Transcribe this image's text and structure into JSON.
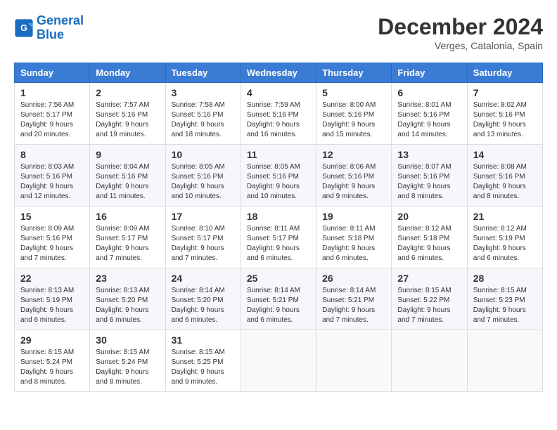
{
  "header": {
    "logo_general": "General",
    "logo_blue": "Blue",
    "month": "December 2024",
    "location": "Verges, Catalonia, Spain"
  },
  "weekdays": [
    "Sunday",
    "Monday",
    "Tuesday",
    "Wednesday",
    "Thursday",
    "Friday",
    "Saturday"
  ],
  "weeks": [
    [
      {
        "day": "1",
        "sunrise": "Sunrise: 7:56 AM",
        "sunset": "Sunset: 5:17 PM",
        "daylight": "Daylight: 9 hours and 20 minutes."
      },
      {
        "day": "2",
        "sunrise": "Sunrise: 7:57 AM",
        "sunset": "Sunset: 5:16 PM",
        "daylight": "Daylight: 9 hours and 19 minutes."
      },
      {
        "day": "3",
        "sunrise": "Sunrise: 7:58 AM",
        "sunset": "Sunset: 5:16 PM",
        "daylight": "Daylight: 9 hours and 18 minutes."
      },
      {
        "day": "4",
        "sunrise": "Sunrise: 7:59 AM",
        "sunset": "Sunset: 5:16 PM",
        "daylight": "Daylight: 9 hours and 16 minutes."
      },
      {
        "day": "5",
        "sunrise": "Sunrise: 8:00 AM",
        "sunset": "Sunset: 5:16 PM",
        "daylight": "Daylight: 9 hours and 15 minutes."
      },
      {
        "day": "6",
        "sunrise": "Sunrise: 8:01 AM",
        "sunset": "Sunset: 5:16 PM",
        "daylight": "Daylight: 9 hours and 14 minutes."
      },
      {
        "day": "7",
        "sunrise": "Sunrise: 8:02 AM",
        "sunset": "Sunset: 5:16 PM",
        "daylight": "Daylight: 9 hours and 13 minutes."
      }
    ],
    [
      {
        "day": "8",
        "sunrise": "Sunrise: 8:03 AM",
        "sunset": "Sunset: 5:16 PM",
        "daylight": "Daylight: 9 hours and 12 minutes."
      },
      {
        "day": "9",
        "sunrise": "Sunrise: 8:04 AM",
        "sunset": "Sunset: 5:16 PM",
        "daylight": "Daylight: 9 hours and 11 minutes."
      },
      {
        "day": "10",
        "sunrise": "Sunrise: 8:05 AM",
        "sunset": "Sunset: 5:16 PM",
        "daylight": "Daylight: 9 hours and 10 minutes."
      },
      {
        "day": "11",
        "sunrise": "Sunrise: 8:05 AM",
        "sunset": "Sunset: 5:16 PM",
        "daylight": "Daylight: 9 hours and 10 minutes."
      },
      {
        "day": "12",
        "sunrise": "Sunrise: 8:06 AM",
        "sunset": "Sunset: 5:16 PM",
        "daylight": "Daylight: 9 hours and 9 minutes."
      },
      {
        "day": "13",
        "sunrise": "Sunrise: 8:07 AM",
        "sunset": "Sunset: 5:16 PM",
        "daylight": "Daylight: 9 hours and 8 minutes."
      },
      {
        "day": "14",
        "sunrise": "Sunrise: 8:08 AM",
        "sunset": "Sunset: 5:16 PM",
        "daylight": "Daylight: 9 hours and 8 minutes."
      }
    ],
    [
      {
        "day": "15",
        "sunrise": "Sunrise: 8:09 AM",
        "sunset": "Sunset: 5:16 PM",
        "daylight": "Daylight: 9 hours and 7 minutes."
      },
      {
        "day": "16",
        "sunrise": "Sunrise: 8:09 AM",
        "sunset": "Sunset: 5:17 PM",
        "daylight": "Daylight: 9 hours and 7 minutes."
      },
      {
        "day": "17",
        "sunrise": "Sunrise: 8:10 AM",
        "sunset": "Sunset: 5:17 PM",
        "daylight": "Daylight: 9 hours and 7 minutes."
      },
      {
        "day": "18",
        "sunrise": "Sunrise: 8:11 AM",
        "sunset": "Sunset: 5:17 PM",
        "daylight": "Daylight: 9 hours and 6 minutes."
      },
      {
        "day": "19",
        "sunrise": "Sunrise: 8:11 AM",
        "sunset": "Sunset: 5:18 PM",
        "daylight": "Daylight: 9 hours and 6 minutes."
      },
      {
        "day": "20",
        "sunrise": "Sunrise: 8:12 AM",
        "sunset": "Sunset: 5:18 PM",
        "daylight": "Daylight: 9 hours and 6 minutes."
      },
      {
        "day": "21",
        "sunrise": "Sunrise: 8:12 AM",
        "sunset": "Sunset: 5:19 PM",
        "daylight": "Daylight: 9 hours and 6 minutes."
      }
    ],
    [
      {
        "day": "22",
        "sunrise": "Sunrise: 8:13 AM",
        "sunset": "Sunset: 5:19 PM",
        "daylight": "Daylight: 9 hours and 6 minutes."
      },
      {
        "day": "23",
        "sunrise": "Sunrise: 8:13 AM",
        "sunset": "Sunset: 5:20 PM",
        "daylight": "Daylight: 9 hours and 6 minutes."
      },
      {
        "day": "24",
        "sunrise": "Sunrise: 8:14 AM",
        "sunset": "Sunset: 5:20 PM",
        "daylight": "Daylight: 9 hours and 6 minutes."
      },
      {
        "day": "25",
        "sunrise": "Sunrise: 8:14 AM",
        "sunset": "Sunset: 5:21 PM",
        "daylight": "Daylight: 9 hours and 6 minutes."
      },
      {
        "day": "26",
        "sunrise": "Sunrise: 8:14 AM",
        "sunset": "Sunset: 5:21 PM",
        "daylight": "Daylight: 9 hours and 7 minutes."
      },
      {
        "day": "27",
        "sunrise": "Sunrise: 8:15 AM",
        "sunset": "Sunset: 5:22 PM",
        "daylight": "Daylight: 9 hours and 7 minutes."
      },
      {
        "day": "28",
        "sunrise": "Sunrise: 8:15 AM",
        "sunset": "Sunset: 5:23 PM",
        "daylight": "Daylight: 9 hours and 7 minutes."
      }
    ],
    [
      {
        "day": "29",
        "sunrise": "Sunrise: 8:15 AM",
        "sunset": "Sunset: 5:24 PM",
        "daylight": "Daylight: 9 hours and 8 minutes."
      },
      {
        "day": "30",
        "sunrise": "Sunrise: 8:15 AM",
        "sunset": "Sunset: 5:24 PM",
        "daylight": "Daylight: 9 hours and 8 minutes."
      },
      {
        "day": "31",
        "sunrise": "Sunrise: 8:15 AM",
        "sunset": "Sunset: 5:25 PM",
        "daylight": "Daylight: 9 hours and 9 minutes."
      },
      null,
      null,
      null,
      null
    ]
  ]
}
